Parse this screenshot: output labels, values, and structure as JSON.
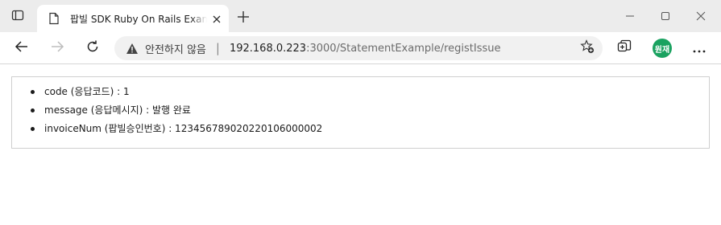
{
  "browser": {
    "tab": {
      "title": "팝빌 SDK Ruby On Rails Example",
      "close_label": "×"
    },
    "new_tab_label": "+",
    "address_bar": {
      "security_text": "안전하지 않음",
      "separator": "|",
      "url_host": "192.168.0.223",
      "url_rest": ":3000/StatementExample/registIssue"
    },
    "profile_label": "원재",
    "colors": {
      "profile_bg": "#1aa260",
      "tabstrip_bg": "#ececec",
      "address_bg": "#f1f1f1"
    }
  },
  "page": {
    "results": [
      {
        "text": "code (응답코드) : 1"
      },
      {
        "text": "message (응답메시지) : 발행 완료"
      },
      {
        "text": "invoiceNum (팝빌승인번호) : 12345678902022010600000​2"
      }
    ]
  }
}
